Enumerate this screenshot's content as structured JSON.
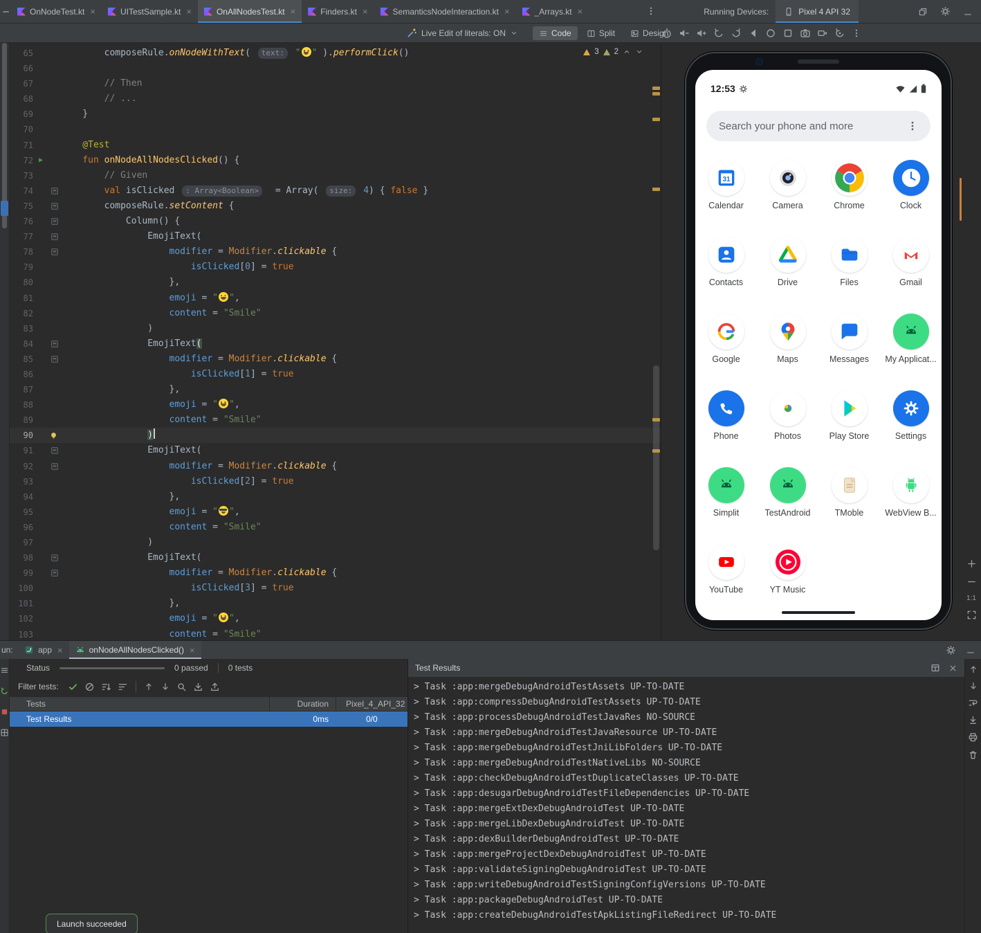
{
  "colors": {
    "accent": "#4a88c7",
    "selection": "#3974bb",
    "android_green": "#3ddc84",
    "warning": "#d9a84e"
  },
  "title_bar": {
    "editor_tabs": [
      {
        "label": "OnNodeTest.kt",
        "active": false
      },
      {
        "label": "UITestSample.kt",
        "active": false
      },
      {
        "label": "OnAllNodesTest.kt",
        "active": true
      },
      {
        "label": "Finders.kt",
        "active": false
      },
      {
        "label": "SemanticsNodeInteraction.kt",
        "active": false
      },
      {
        "label": "_Arrays.kt",
        "active": false
      }
    ],
    "running_devices_label": "Running Devices:",
    "device_tab_label": "Pixel 4 API 32",
    "window_icons": [
      {
        "n": "float-window",
        "i": "restore"
      },
      {
        "n": "settings-gear",
        "i": "gear"
      },
      {
        "n": "hide-panel",
        "i": "hide"
      }
    ]
  },
  "toolbar": {
    "live_edit_label": "Live Edit of literals: ON",
    "view_modes": [
      {
        "label": "Code",
        "icon": "code-view",
        "active": true
      },
      {
        "label": "Split",
        "icon": "split-view",
        "active": false
      },
      {
        "label": "Design",
        "icon": "design-view",
        "active": false
      }
    ],
    "device_controls": [
      "power",
      "volume-down",
      "volume-up",
      "rotate-left",
      "rotate-right",
      "back",
      "home",
      "overview",
      "screenshot",
      "record",
      "snapshot",
      "more"
    ]
  },
  "editor": {
    "warnings": "3",
    "weak_warnings": "2",
    "scroll_marks": [
      63,
      71,
      108,
      209,
      542,
      587
    ],
    "lines": [
      {
        "n": 65,
        "s": [
          [
            "pl",
            "        composeRule."
          ],
          [
            "fni",
            "onNodeWithText"
          ],
          [
            "pl",
            "( "
          ],
          [
            "hint",
            "text:"
          ],
          [
            "pl",
            " "
          ],
          [
            "str",
            "\""
          ],
          [
            "emj",
            ""
          ],
          [
            "str",
            "\" "
          ],
          [
            "pl",
            ")."
          ],
          [
            "fni",
            "performClick"
          ],
          [
            "pl",
            "()"
          ]
        ]
      },
      {
        "n": 66,
        "s": []
      },
      {
        "n": 67,
        "s": [
          [
            "com",
            "        // Then"
          ]
        ]
      },
      {
        "n": 68,
        "s": [
          [
            "com",
            "        // ..."
          ]
        ]
      },
      {
        "n": 69,
        "s": [
          [
            "pl",
            "    }"
          ]
        ]
      },
      {
        "n": 70,
        "s": []
      },
      {
        "n": 71,
        "s": [
          [
            "ann",
            "    @Test"
          ]
        ]
      },
      {
        "n": 72,
        "g": "run",
        "s": [
          [
            "kw",
            "    fun "
          ],
          [
            "fn",
            "onNodeAllNodesClicked"
          ],
          [
            "pl",
            "() {"
          ]
        ]
      },
      {
        "n": 73,
        "s": [
          [
            "com",
            "        // Given"
          ]
        ]
      },
      {
        "n": 74,
        "g": "fold",
        "s": [
          [
            "kw",
            "        val "
          ],
          [
            "pl",
            "isClicked "
          ],
          [
            "hint",
            ": Array<Boolean>"
          ],
          [
            "pl",
            "  = Array( "
          ],
          [
            "hint",
            "size:"
          ],
          [
            "pl",
            " "
          ],
          [
            "num",
            "4"
          ],
          [
            "pl",
            ") { "
          ],
          [
            "kw",
            "false"
          ],
          [
            "pl",
            " }"
          ]
        ]
      },
      {
        "n": 75,
        "g": "fold",
        "s": [
          [
            "pl",
            "        composeRule."
          ],
          [
            "fni",
            "setContent"
          ],
          [
            "pl",
            " {"
          ]
        ]
      },
      {
        "n": 76,
        "g": "fold",
        "s": [
          [
            "pl",
            "            Column() {"
          ]
        ]
      },
      {
        "n": 77,
        "g": "fold",
        "s": [
          [
            "pl",
            "                EmojiText("
          ]
        ]
      },
      {
        "n": 78,
        "g": "fold",
        "s": [
          [
            "prm",
            "                    modifier"
          ],
          [
            "pl",
            " = "
          ],
          [
            "cls",
            "Modifier"
          ],
          [
            "pl",
            "."
          ],
          [
            "fni",
            "clickable"
          ],
          [
            "pl",
            " {"
          ]
        ]
      },
      {
        "n": 79,
        "s": [
          [
            "prm",
            "                        isClicked"
          ],
          [
            "pl",
            "["
          ],
          [
            "num",
            "0"
          ],
          [
            "pl",
            "] = "
          ],
          [
            "kw",
            "true"
          ]
        ]
      },
      {
        "n": 80,
        "s": [
          [
            "pl",
            "                    },"
          ]
        ]
      },
      {
        "n": 81,
        "s": [
          [
            "prm",
            "                    emoji"
          ],
          [
            "pl",
            " = "
          ],
          [
            "str",
            "\""
          ],
          [
            "emj",
            ""
          ],
          [
            "str",
            "\""
          ],
          [
            "pl",
            ","
          ]
        ]
      },
      {
        "n": 82,
        "s": [
          [
            "prm",
            "                    content"
          ],
          [
            "pl",
            " = "
          ],
          [
            "str",
            "\"Smile\""
          ]
        ]
      },
      {
        "n": 83,
        "s": [
          [
            "pl",
            "                )"
          ]
        ]
      },
      {
        "n": 84,
        "g": "fold",
        "s": [
          [
            "pl",
            "                EmojiText"
          ],
          [
            "brace",
            "("
          ]
        ]
      },
      {
        "n": 85,
        "g": "fold",
        "s": [
          [
            "prm",
            "                    modifier"
          ],
          [
            "pl",
            " = "
          ],
          [
            "cls",
            "Modifier"
          ],
          [
            "pl",
            "."
          ],
          [
            "fni",
            "clickable"
          ],
          [
            "pl",
            " {"
          ]
        ]
      },
      {
        "n": 86,
        "s": [
          [
            "prm",
            "                        isClicked"
          ],
          [
            "pl",
            "["
          ],
          [
            "num",
            "1"
          ],
          [
            "pl",
            "] = "
          ],
          [
            "kw",
            "true"
          ]
        ]
      },
      {
        "n": 87,
        "s": [
          [
            "pl",
            "                    },"
          ]
        ]
      },
      {
        "n": 88,
        "s": [
          [
            "prm",
            "                    emoji"
          ],
          [
            "pl",
            " = "
          ],
          [
            "str",
            "\""
          ],
          [
            "emj",
            ""
          ],
          [
            "str",
            "\""
          ],
          [
            "pl",
            ","
          ]
        ]
      },
      {
        "n": 89,
        "s": [
          [
            "prm",
            "                    content"
          ],
          [
            "pl",
            " = "
          ],
          [
            "str",
            "\"Smile\""
          ]
        ]
      },
      {
        "n": 90,
        "g": "bulb",
        "c": true,
        "s": [
          [
            "pl",
            "                "
          ],
          [
            "brace",
            ")"
          ]
        ]
      },
      {
        "n": 91,
        "g": "fold",
        "s": [
          [
            "pl",
            "                EmojiText("
          ]
        ]
      },
      {
        "n": 92,
        "g": "fold",
        "s": [
          [
            "prm",
            "                    modifier"
          ],
          [
            "pl",
            " = "
          ],
          [
            "cls",
            "Modifier"
          ],
          [
            "pl",
            "."
          ],
          [
            "fni",
            "clickable"
          ],
          [
            "pl",
            " {"
          ]
        ]
      },
      {
        "n": 93,
        "s": [
          [
            "prm",
            "                        isClicked"
          ],
          [
            "pl",
            "["
          ],
          [
            "num",
            "2"
          ],
          [
            "pl",
            "] = "
          ],
          [
            "kw",
            "true"
          ]
        ]
      },
      {
        "n": 94,
        "s": [
          [
            "pl",
            "                    },"
          ]
        ]
      },
      {
        "n": 95,
        "s": [
          [
            "prm",
            "                    emoji"
          ],
          [
            "pl",
            " = "
          ],
          [
            "str",
            "\""
          ],
          [
            "emjc",
            ""
          ],
          [
            "str",
            "\""
          ],
          [
            "pl",
            ","
          ]
        ]
      },
      {
        "n": 96,
        "s": [
          [
            "prm",
            "                    content"
          ],
          [
            "pl",
            " = "
          ],
          [
            "str",
            "\"Smile\""
          ]
        ]
      },
      {
        "n": 97,
        "s": [
          [
            "pl",
            "                )"
          ]
        ]
      },
      {
        "n": 98,
        "g": "fold",
        "s": [
          [
            "pl",
            "                EmojiText("
          ]
        ]
      },
      {
        "n": 99,
        "g": "fold",
        "s": [
          [
            "prm",
            "                    modifier"
          ],
          [
            "pl",
            " = "
          ],
          [
            "cls",
            "Modifier"
          ],
          [
            "pl",
            "."
          ],
          [
            "fni",
            "clickable"
          ],
          [
            "pl",
            " {"
          ]
        ]
      },
      {
        "n": 100,
        "s": [
          [
            "prm",
            "                        isClicked"
          ],
          [
            "pl",
            "["
          ],
          [
            "num",
            "3"
          ],
          [
            "pl",
            "] = "
          ],
          [
            "kw",
            "true"
          ]
        ]
      },
      {
        "n": 101,
        "s": [
          [
            "pl",
            "                    },"
          ]
        ]
      },
      {
        "n": 102,
        "s": [
          [
            "prm",
            "                    emoji"
          ],
          [
            "pl",
            " = "
          ],
          [
            "str",
            "\""
          ],
          [
            "emj",
            ""
          ],
          [
            "str",
            "\""
          ],
          [
            "pl",
            ","
          ]
        ]
      },
      {
        "n": 103,
        "s": [
          [
            "prm",
            "                    content"
          ],
          [
            "pl",
            " = "
          ],
          [
            "str",
            "\"Smile\""
          ]
        ]
      }
    ]
  },
  "emulator": {
    "status_time": "12:53",
    "search_placeholder": "Search your phone and more",
    "zoom_label": "1:1",
    "apps": [
      {
        "label": "Calendar",
        "icon": "calendar"
      },
      {
        "label": "Camera",
        "icon": "camera"
      },
      {
        "label": "Chrome",
        "icon": "chrome"
      },
      {
        "label": "Clock",
        "icon": "clock"
      },
      {
        "label": "Contacts",
        "icon": "contacts"
      },
      {
        "label": "Drive",
        "icon": "drive"
      },
      {
        "label": "Files",
        "icon": "files"
      },
      {
        "label": "Gmail",
        "icon": "gmail"
      },
      {
        "label": "Google",
        "icon": "google"
      },
      {
        "label": "Maps",
        "icon": "maps"
      },
      {
        "label": "Messages",
        "icon": "messages"
      },
      {
        "label": "My Applicat...",
        "icon": "android-app"
      },
      {
        "label": "Phone",
        "icon": "phone-app"
      },
      {
        "label": "Photos",
        "icon": "photos"
      },
      {
        "label": "Play Store",
        "icon": "play-store"
      },
      {
        "label": "Settings",
        "icon": "settings-app"
      },
      {
        "label": "Simplit",
        "icon": "android-app"
      },
      {
        "label": "TestAndroid",
        "icon": "android-app"
      },
      {
        "label": "TMoble",
        "icon": "document-app"
      },
      {
        "label": "WebView B...",
        "icon": "webview-app"
      },
      {
        "label": "YouTube",
        "icon": "youtube"
      },
      {
        "label": "YT Music",
        "icon": "yt-music"
      }
    ]
  },
  "run_panel": {
    "run_label": "un:",
    "tabs": [
      {
        "label": "app",
        "icon": "gradle",
        "active": false
      },
      {
        "label": "onNodeAllNodesClicked()",
        "icon": "android",
        "active": true
      }
    ],
    "tab_icons": [
      {
        "n": "run-settings",
        "i": "gear"
      },
      {
        "n": "hide-run-panel",
        "i": "hide"
      }
    ],
    "status_label": "Status",
    "passed_label": "0 passed",
    "tests_label": "0 tests",
    "filter_label": "Filter tests:",
    "filter_icons": [
      {
        "n": "show-passed",
        "i": "check"
      },
      {
        "n": "show-ignored",
        "i": "circle-slash"
      },
      {
        "n": "sort-alphabetically",
        "i": "sort-alpha"
      },
      {
        "n": "sort-by-duration",
        "i": "sort-duration"
      },
      {
        "n": "sep"
      },
      {
        "n": "previous-occurrence",
        "i": "arrow-up"
      },
      {
        "n": "next-occurrence",
        "i": "arrow-down"
      },
      {
        "n": "test-history",
        "i": "magnifier"
      },
      {
        "n": "import-tests",
        "i": "import"
      },
      {
        "n": "export-tests",
        "i": "export"
      }
    ],
    "table": {
      "columns": [
        "Tests",
        "Duration",
        "Pixel_4_API_32"
      ],
      "row": {
        "name": "Test Results",
        "duration": "0ms",
        "result": "0/0"
      }
    },
    "console_title": "Test Results",
    "console_header_icons": [
      {
        "n": "change-view-layout",
        "i": "layout"
      },
      {
        "n": "close-console",
        "i": "close"
      }
    ],
    "console_lines": [
      "> Task :app:mergeDebugAndroidTestAssets UP-TO-DATE",
      "> Task :app:compressDebugAndroidTestAssets UP-TO-DATE",
      "> Task :app:processDebugAndroidTestJavaRes NO-SOURCE",
      "> Task :app:mergeDebugAndroidTestJavaResource UP-TO-DATE",
      "> Task :app:mergeDebugAndroidTestJniLibFolders UP-TO-DATE",
      "> Task :app:mergeDebugAndroidTestNativeLibs NO-SOURCE",
      "> Task :app:checkDebugAndroidTestDuplicateClasses UP-TO-DATE",
      "> Task :app:desugarDebugAndroidTestFileDependencies UP-TO-DATE",
      "> Task :app:mergeExtDexDebugAndroidTest UP-TO-DATE",
      "> Task :app:mergeLibDexDebugAndroidTest UP-TO-DATE",
      "> Task :app:dexBuilderDebugAndroidTest UP-TO-DATE",
      "> Task :app:mergeProjectDexDebugAndroidTest UP-TO-DATE",
      "> Task :app:validateSigningDebugAndroidTest UP-TO-DATE",
      "> Task :app:writeDebugAndroidTestSigningConfigVersions UP-TO-DATE",
      "> Task :app:packageDebugAndroidTest UP-TO-DATE",
      "> Task :app:createDebugAndroidTestApkListingFileRedirect UP-TO-DATE"
    ],
    "console_strip": [
      {
        "n": "scroll-up",
        "i": "arrow-up"
      },
      {
        "n": "scroll-down",
        "i": "arrow-down"
      },
      {
        "n": "soft-wrap",
        "i": "soft-wrap"
      },
      {
        "n": "scroll-to-end",
        "i": "scroll-end"
      },
      {
        "n": "print",
        "i": "print"
      },
      {
        "n": "clear-all",
        "i": "clear"
      }
    ],
    "tool_stripe": [
      {
        "n": "structure",
        "i": "list"
      },
      {
        "n": "rerun",
        "i": "rerun"
      },
      {
        "n": "stop",
        "i": "stop"
      },
      {
        "n": "layout",
        "i": "grid"
      }
    ],
    "launch_badge": "Launch succeeded"
  }
}
